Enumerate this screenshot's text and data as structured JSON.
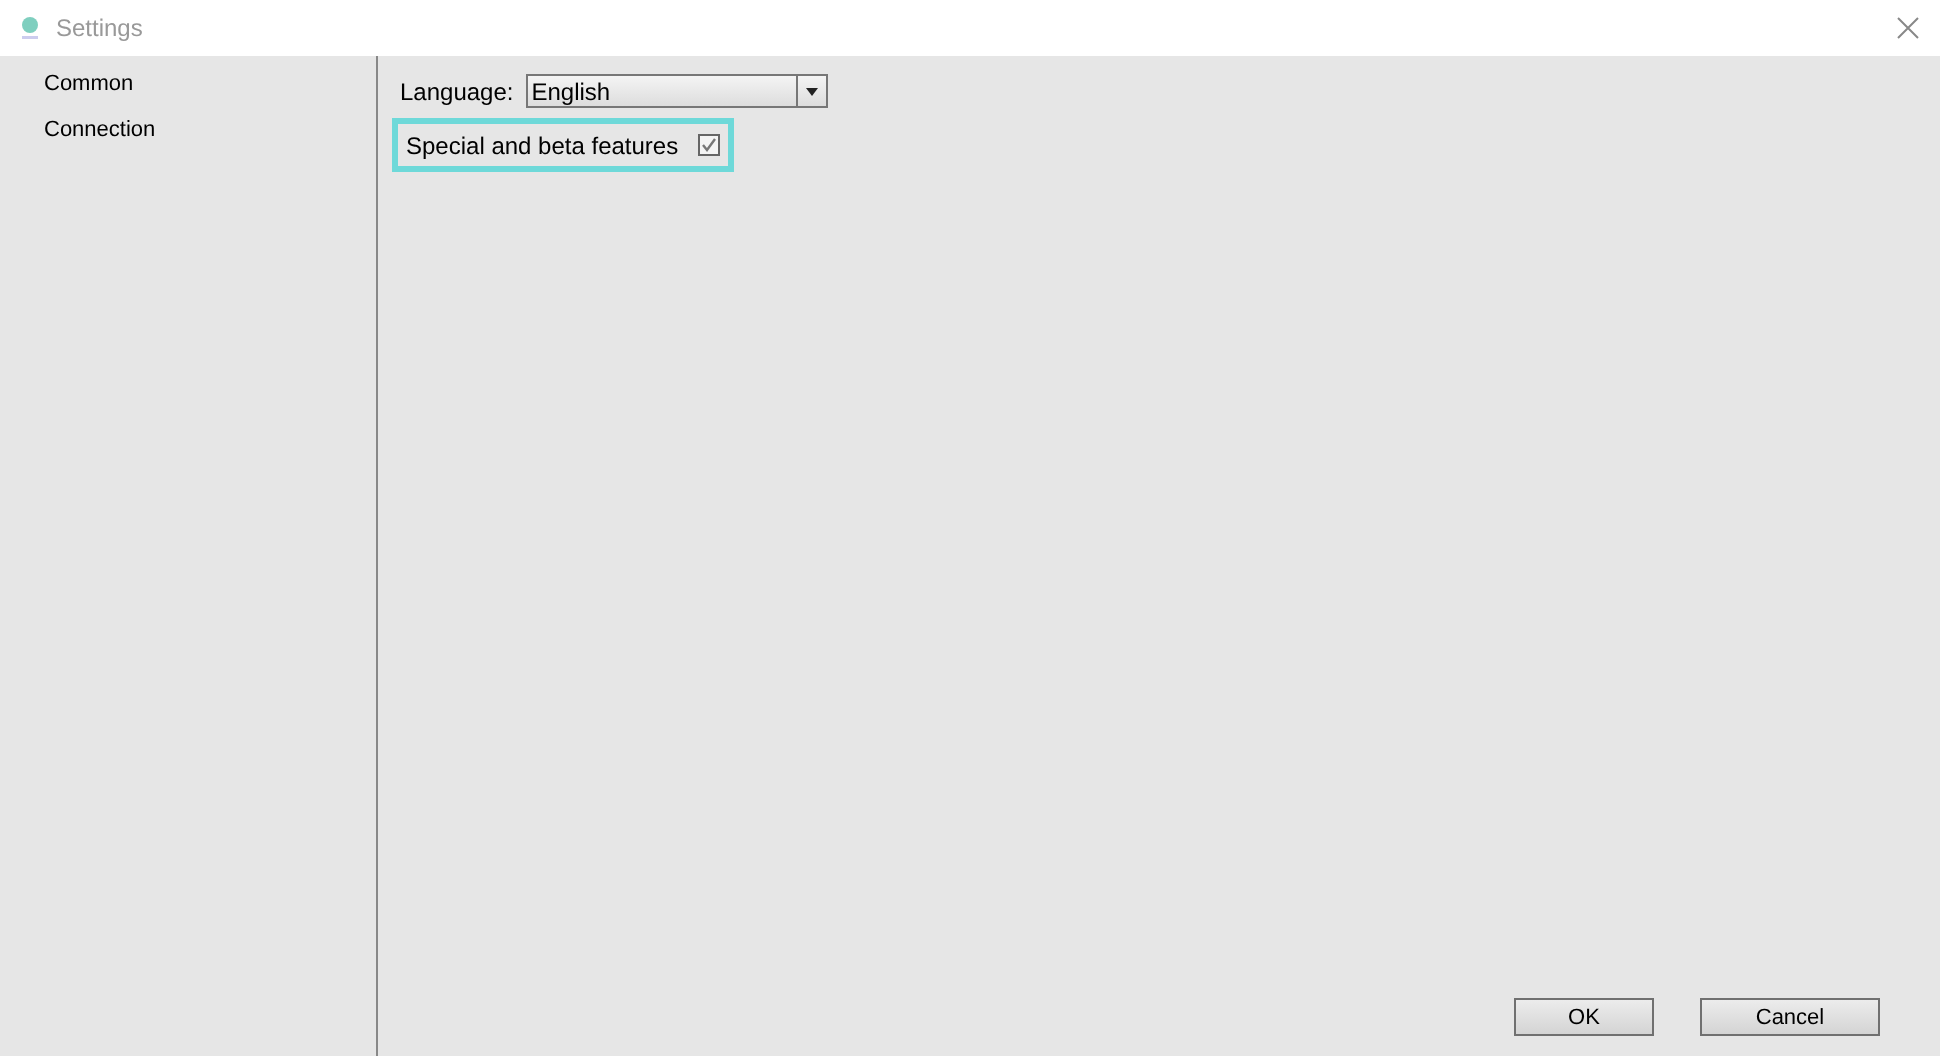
{
  "window": {
    "title": "Settings"
  },
  "sidebar": {
    "items": [
      {
        "label": "Common",
        "selected": false
      },
      {
        "label": "Connection",
        "selected": false
      }
    ]
  },
  "language": {
    "label": "Language:",
    "value": "English"
  },
  "beta": {
    "label": "Special and beta features",
    "checked": true,
    "highlighted": true
  },
  "buttons": [
    {
      "label": "OK"
    },
    {
      "label": "Cancel"
    }
  ]
}
